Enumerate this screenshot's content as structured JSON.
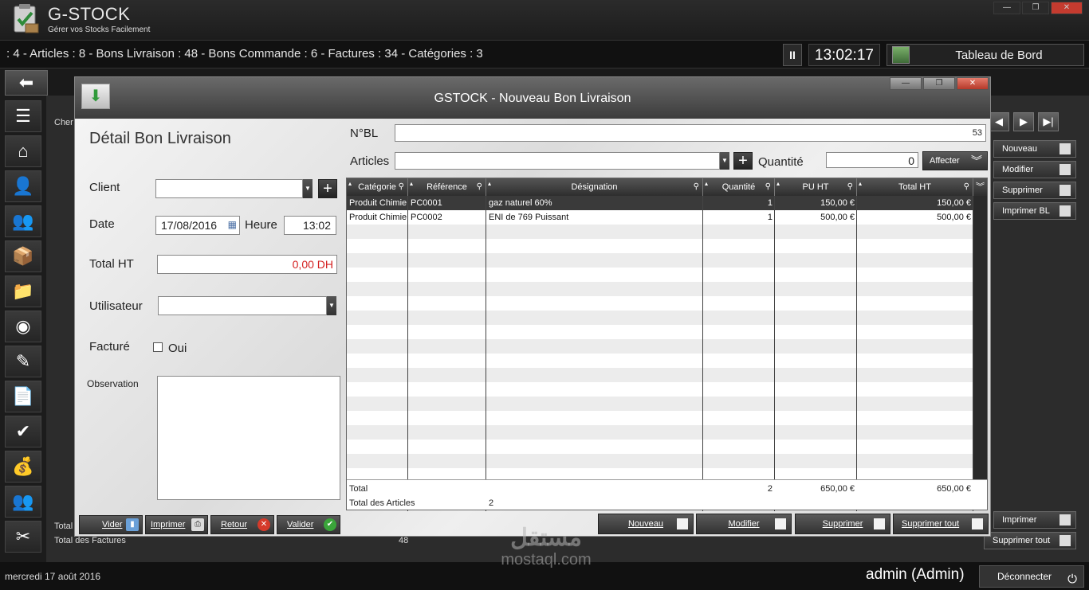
{
  "app": {
    "name": "G-STOCK",
    "subtitle": "Gérer vos Stocks Facilement"
  },
  "stats": {
    "text": ": 4 - Articles : 8 - Bons Livraison : 48 - Bons Commande : 6 -  Factures : 34 - Catégories : 3",
    "pause": "II",
    "clock": "13:02:17",
    "dashboard": "Tableau de Bord"
  },
  "background": {
    "chercher": "Cher",
    "total": "Total",
    "total_factures": "Total des Factures",
    "total_factures_value": "48",
    "right_buttons": [
      "Nouveau",
      "Modifier",
      "Supprimer",
      "Imprimer BL"
    ],
    "bottom_buttons": [
      "Imprimer",
      "Supprimer tout"
    ]
  },
  "modal": {
    "title": "GSTOCK - Nouveau Bon Livraison",
    "form_title": "Détail Bon Livraison",
    "labels": {
      "client": "Client",
      "date": "Date",
      "heure": "Heure",
      "total_ht": "Total HT",
      "utilisateur": "Utilisateur",
      "facture": "Facturé",
      "oui": "Oui",
      "observation": "Observation",
      "nbl": "N°BL",
      "articles": "Articles",
      "quantite": "Quantité"
    },
    "values": {
      "client": "",
      "date": "17/08/2016",
      "heure": "13:02",
      "total_ht": "0,00 DH",
      "utilisateur": "",
      "facture_checked": false,
      "observation": "",
      "nbl": "53",
      "articles": "",
      "quantite": "0"
    },
    "affecter": "Affecter",
    "left_buttons": {
      "vider": "Vider",
      "imprimer": "Imprimer",
      "retour": "Retour",
      "valider": "Valider"
    },
    "grid": {
      "columns": [
        "Catégorie",
        "Référence",
        "Désignation",
        "Quantité",
        "PU HT",
        "Total HT"
      ],
      "rows": [
        [
          "Produit Chimie",
          "PC0001",
          "gaz naturel 60%",
          "1",
          "150,00 €",
          "150,00 €"
        ],
        [
          "Produit Chimie",
          "PC0002",
          "ENI de 769 Puissant",
          "1",
          "500,00 €",
          "500,00 €"
        ]
      ],
      "total_label": "Total",
      "total_qty": "2",
      "total_pu": "650,00 €",
      "total_ht": "650,00 €",
      "total_articles_label": "Total des Articles",
      "total_articles_value": "2"
    },
    "action_buttons": {
      "nouveau": "Nouveau",
      "modifier": "Modifier",
      "supprimer": "Supprimer",
      "supprimer_tout": "Supprimer tout"
    }
  },
  "status": {
    "date": "mercredi 17 août 2016",
    "user": "admin (Admin)",
    "logout": "Déconnecter"
  },
  "watermark": {
    "arabic": "مستقل",
    "latin": "mostaql.com"
  }
}
